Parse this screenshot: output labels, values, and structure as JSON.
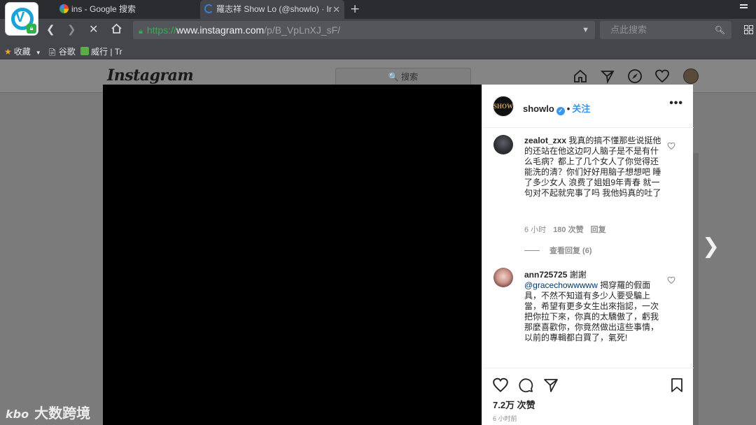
{
  "browser": {
    "tabs": [
      {
        "title": "ins - Google 搜索",
        "active": false
      },
      {
        "title": "羅志祥 Show Lo (@showlo) · Ir",
        "active": true
      }
    ],
    "new_tab_label": "+",
    "address": {
      "scheme": "https://",
      "host": "www.instagram.com",
      "path": "/p/B_VpLnXJ_sF/"
    },
    "search_placeholder": "点此搜索",
    "bookmarks": [
      {
        "label": "收藏",
        "icon": "star-icon"
      },
      {
        "label": "谷歌",
        "icon": "page-icon"
      },
      {
        "label": "威行 | Tr",
        "icon": "trello-icon"
      }
    ]
  },
  "instagram": {
    "logo": "Instagram",
    "search_placeholder": "🔍 搜索",
    "post": {
      "username": "showlo",
      "avatar_text": "SHOW",
      "separator": "•",
      "follow_label": "关注",
      "more_label": "•••",
      "likes": "7.2万 次赞",
      "time_ago": "6 小时前"
    },
    "comments": [
      {
        "username": "zealot_zxx",
        "text": "我真的搞不懂那些说挺他的还站在他这边叼人脑子是不是有什么毛病？都上了几个女人了你觉得还能洗的清？你们好好用脑子想想吧 睡了多少女人 浪费了姐姐9年青春 就一句对不起就完事了吗 我他妈真的吐了",
        "time": "6 小时",
        "likes": "180 次赞",
        "reply_label": "回复",
        "view_replies": "查看回复 (6)"
      },
      {
        "username": "ann725725",
        "lead": "謝謝",
        "mention": "@gracechowwwww",
        "text": "揭穿羅的假面具，不然不知道有多少人要受騙上當，希望有更多女生出來指認，一次把你拉下來，你真的太驕傲了，虧我那麼喜歡你，你竟然做出這些事情，以前的專輯都白買了，氣死!"
      }
    ]
  },
  "watermark": {
    "logo": "kbo",
    "text": "大数跨境"
  },
  "colors": {
    "accent": "#3897f0",
    "secure": "#2fb04f",
    "chrome": "#45464b"
  }
}
